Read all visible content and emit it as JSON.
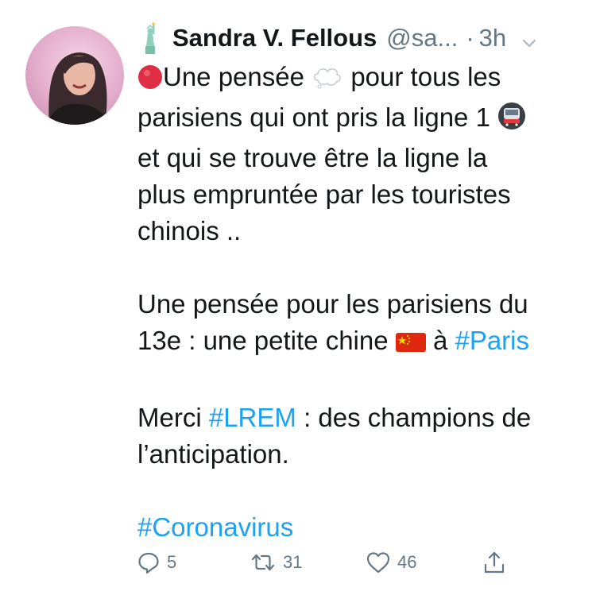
{
  "author": {
    "name": "Sandra V. Fellous",
    "handle": "@sa...",
    "separator": "·",
    "time": "3h"
  },
  "icons": {
    "name_emoji": "statue-of-liberty-icon",
    "menu": "chevron-down-icon",
    "reply": "reply-icon",
    "retweet": "retweet-icon",
    "like": "heart-icon",
    "share": "share-icon"
  },
  "tweet": {
    "p1": {
      "line1_text": "Une pensée",
      "line1_text2": "pour tous les",
      "line2_text": "parisiens qui ont pris la ligne 1",
      "line3": "et qui se trouve être la ligne la",
      "line4": "plus empruntée par les touristes",
      "line5": "chinois .."
    },
    "p2": {
      "line1": "Une pensée pour les parisiens du",
      "line2_text": "13e : une petite chine",
      "line2_text2": "à",
      "line2_hashtag": "#Paris"
    },
    "p3": {
      "line1_text": "Merci",
      "line1_hashtag": "#LREM",
      "line1_text2": ": des champions de",
      "line2": "l’anticipation."
    },
    "p4": {
      "hashtag": "#Coronavirus"
    },
    "emojis": [
      "red-circle-icon",
      "thought-balloon-icon",
      "metro-icon",
      "china-flag-icon"
    ]
  },
  "stats": {
    "replies": "5",
    "retweets": "31",
    "likes": "46"
  },
  "colors": {
    "text": "#14171a",
    "muted": "#657786",
    "link": "#1da1f2"
  }
}
